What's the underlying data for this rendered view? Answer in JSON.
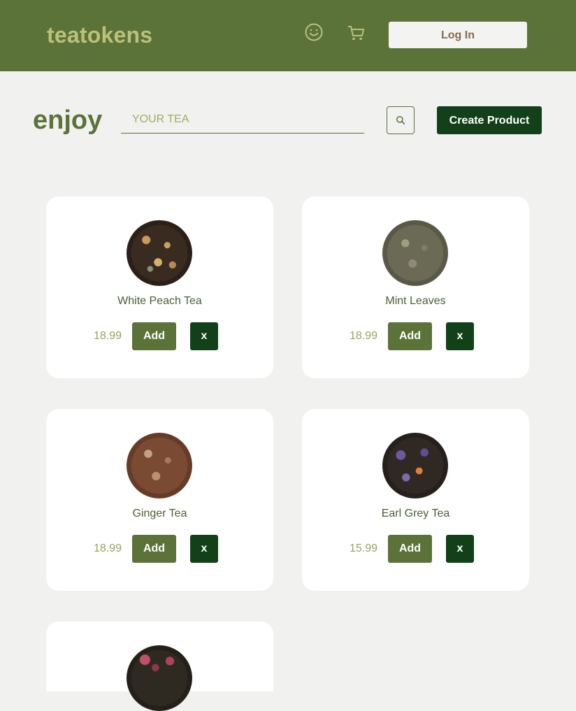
{
  "header": {
    "logo": "teatokens",
    "login_label": "Log In"
  },
  "toolbar": {
    "heading": "enjoy",
    "search_placeholder": "YOUR TEA",
    "create_label": "Create Product"
  },
  "products": [
    {
      "name": "White Peach Tea",
      "price": "18.99",
      "add_label": "Add",
      "remove_label": "x",
      "image": "white-peach-tea-leaves"
    },
    {
      "name": "Mint Leaves",
      "price": "18.99",
      "add_label": "Add",
      "remove_label": "x",
      "image": "mint-leaves"
    },
    {
      "name": "Ginger Tea",
      "price": "18.99",
      "add_label": "Add",
      "remove_label": "x",
      "image": "ginger-tea-leaves"
    },
    {
      "name": "Earl Grey Tea",
      "price": "15.99",
      "add_label": "Add",
      "remove_label": "x",
      "image": "earl-grey-tea-leaves"
    },
    {
      "name": "",
      "price": "",
      "add_label": "",
      "remove_label": "",
      "image": "rose-tea-leaves"
    }
  ],
  "colors": {
    "header_bg": "#5b7338",
    "logo": "#bcc07a",
    "page_bg": "#f1f1ef",
    "accent_dark": "#124019",
    "accent": "#5b7338",
    "price": "#98a35a"
  },
  "icons": {
    "profile": "smile-icon",
    "cart": "cart-icon",
    "search": "search-icon"
  }
}
